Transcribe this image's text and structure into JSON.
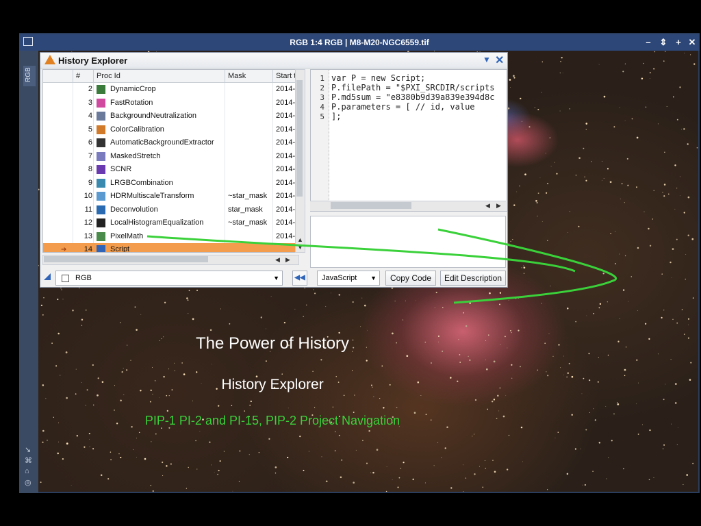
{
  "window": {
    "title": "RGB 1:4 RGB | M8-M20-NGC6559.tif",
    "side_tab": "RGB",
    "controls": [
      "–",
      "⇕",
      "+",
      "✕"
    ]
  },
  "history_explorer": {
    "title": "History Explorer",
    "columns": [
      "#",
      "Proc Id",
      "Mask",
      "Start t"
    ],
    "rows": [
      {
        "n": "2",
        "proc": "DynamicCrop",
        "mask": "",
        "date": "2014-"
      },
      {
        "n": "3",
        "proc": "FastRotation",
        "mask": "",
        "date": "2014-"
      },
      {
        "n": "4",
        "proc": "BackgroundNeutralization",
        "mask": "",
        "date": "2014-"
      },
      {
        "n": "5",
        "proc": "ColorCalibration",
        "mask": "",
        "date": "2014-"
      },
      {
        "n": "6",
        "proc": "AutomaticBackgroundExtractor",
        "mask": "",
        "date": "2014-"
      },
      {
        "n": "7",
        "proc": "MaskedStretch",
        "mask": "",
        "date": "2014-"
      },
      {
        "n": "8",
        "proc": "SCNR",
        "mask": "",
        "date": "2014-"
      },
      {
        "n": "9",
        "proc": "LRGBCombination",
        "mask": "",
        "date": "2014-"
      },
      {
        "n": "10",
        "proc": "HDRMultiscaleTransform",
        "mask": "~star_mask",
        "date": "2014-"
      },
      {
        "n": "11",
        "proc": "Deconvolution",
        "mask": "star_mask",
        "date": "2014-"
      },
      {
        "n": "12",
        "proc": "LocalHistogramEqualization",
        "mask": "~star_mask",
        "date": "2014-"
      },
      {
        "n": "13",
        "proc": "PixelMath",
        "mask": "",
        "date": "2014-"
      },
      {
        "n": "14",
        "proc": "Script",
        "mask": "",
        "date": ""
      }
    ],
    "selected_row": "14",
    "code_lines": [
      {
        "n": "1",
        "text": "var P = new Script;"
      },
      {
        "n": "2",
        "text": "P.filePath = \"$PXI_SRCDIR/scripts"
      },
      {
        "n": "3",
        "text": "P.md5sum = \"e8380b9d39a839e394d8c"
      },
      {
        "n": "4",
        "text": "P.parameters = [ // id, value"
      },
      {
        "n": "5",
        "text": "];"
      }
    ],
    "view_select": "RGB",
    "language_select": "JavaScript",
    "copy_code_label": "Copy Code",
    "edit_description_label": "Edit Description"
  },
  "captions": {
    "title": "The Power of History",
    "subtitle": "History Explorer",
    "note": "PIP-1 PI-2 and PI-15, PIP-2 Project Navigation"
  },
  "colors": {
    "selection": "#f39c4d",
    "accent": "#2f64b8",
    "arrow": "#3ad13a"
  }
}
